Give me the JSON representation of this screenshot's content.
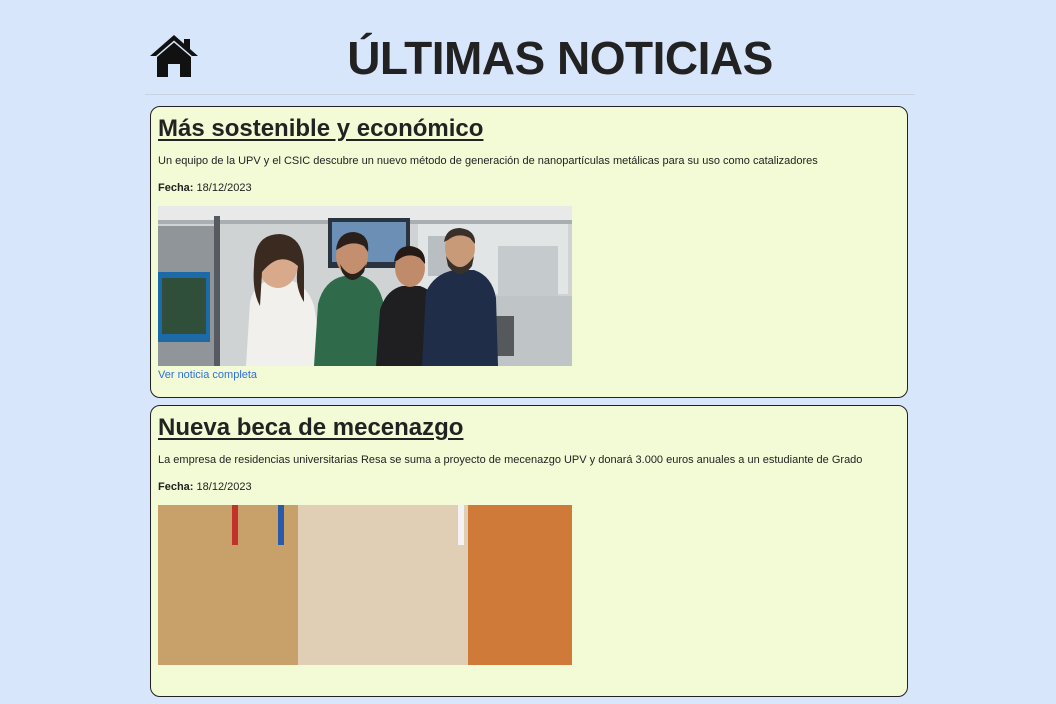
{
  "header": {
    "home_icon": "home-icon",
    "title": "ÚLTIMAS NOTICIAS"
  },
  "news": [
    {
      "title": "Más sostenible y económico",
      "description": "Un equipo de la UPV y el CSIC descubre un nuevo método de generación de nanopartículas metálicas para su uso como catalizadores",
      "date_label": "Fecha:",
      "date": "18/12/2023",
      "link_label": "Ver noticia completa"
    },
    {
      "title": "Nueva beca de mecenazgo",
      "description": "La empresa de residencias universitarias Resa se suma a proyecto de mecenazgo UPV y donará 3.000 euros anuales a un estudiante de Grado",
      "date_label": "Fecha:",
      "date": "18/12/2023"
    }
  ],
  "colors": {
    "page_background": "#d8e6fb",
    "card_background": "#f3fbd6",
    "link": "#2f6fdd",
    "text": "#222222"
  }
}
